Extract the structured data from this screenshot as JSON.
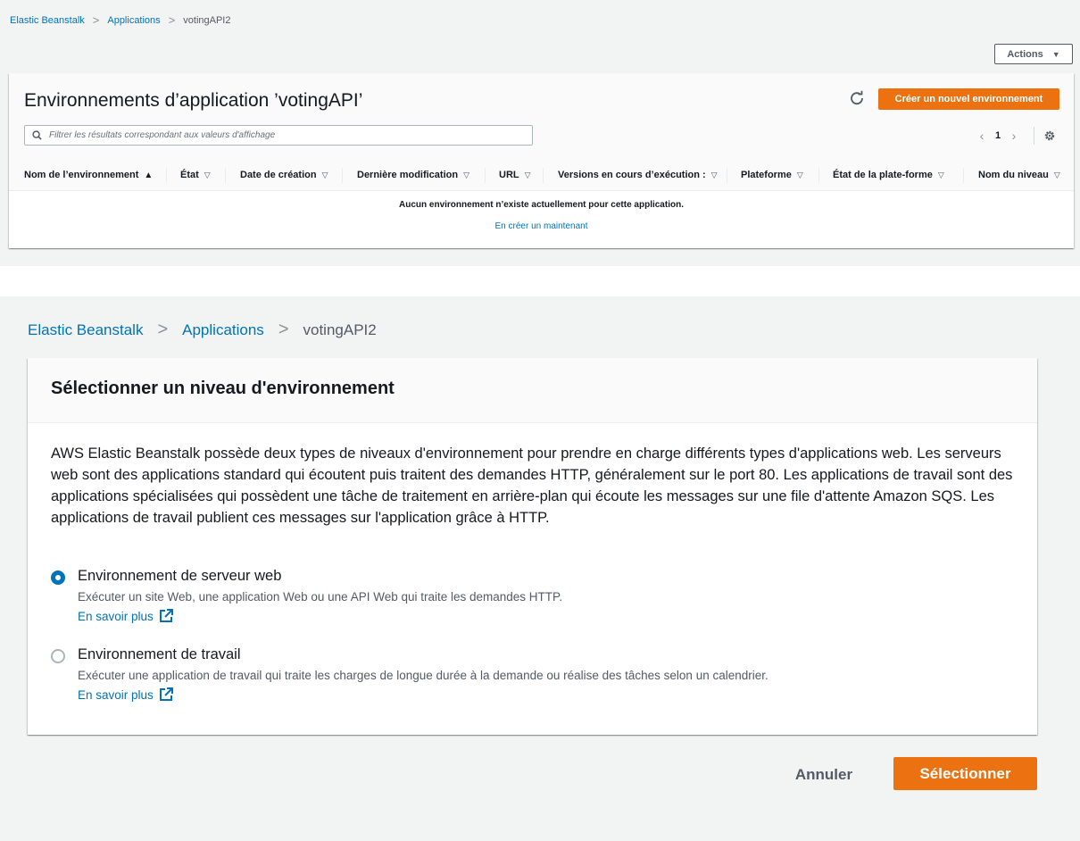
{
  "screenshot1": {
    "breadcrumb": [
      "Elastic Beanstalk",
      "Applications",
      "votingAPI2"
    ],
    "actions_label": "Actions",
    "title": "Environnements d’application ’votingAPI’",
    "create_label": "Créer un nouvel environnement",
    "filter_placeholder": "Filtrer les résultats correspondant aux valeurs d'affichage",
    "page_number": "1",
    "columns": [
      {
        "label": "Nom de l’environnement",
        "sort": "asc"
      },
      {
        "label": "État",
        "sort": "none"
      },
      {
        "label": "Date de création",
        "sort": "none"
      },
      {
        "label": "Dernière modification",
        "sort": "none"
      },
      {
        "label": "URL",
        "sort": "none"
      },
      {
        "label": "Versions en cours d’exécution :",
        "sort": "none"
      },
      {
        "label": "Plateforme",
        "sort": "none"
      },
      {
        "label": "État de la plate-forme",
        "sort": "none"
      },
      {
        "label": "Nom du niveau",
        "sort": "none"
      }
    ],
    "empty_message": "Aucun environnement n’existe actuellement pour cette application.",
    "empty_link": "En créer un maintenant"
  },
  "screenshot2": {
    "breadcrumb": [
      "Elastic Beanstalk",
      "Applications",
      "votingAPI2"
    ],
    "title": "Sélectionner un niveau d'environnement",
    "description": "AWS Elastic Beanstalk possède deux types de niveaux d'environnement pour prendre en charge différents types d'applications web. Les serveurs web sont des applications standard qui écoutent puis traitent des demandes HTTP, généralement sur le port 80. Les applications de travail sont des applications spécialisées qui possèdent une tâche de traitement en arrière-plan qui écoute les messages sur une file d'attente Amazon SQS. Les applications de travail publient ces messages sur l'application grâce à HTTP.",
    "options": [
      {
        "label": "Environnement de serveur web",
        "desc": "Exécuter un site Web, une application Web ou une API Web qui traite les demandes HTTP.",
        "link": "En savoir plus",
        "selected": true
      },
      {
        "label": "Environnement de travail",
        "desc": "Exécuter une application de travail qui traite les charges de longue durée à la demande ou réalise des tâches selon un calendrier.",
        "link": "En savoir plus",
        "selected": false
      }
    ],
    "cancel_label": "Annuler",
    "select_label": "Sélectionner"
  },
  "colors": {
    "accent": "#ec7211",
    "link": "#0073bb",
    "background": "#f2f3f3"
  },
  "icons": [
    "refresh-icon",
    "search-icon",
    "chevron-left-icon",
    "chevron-right-icon",
    "gear-icon",
    "external-link-icon",
    "sort-caret-icon"
  ]
}
